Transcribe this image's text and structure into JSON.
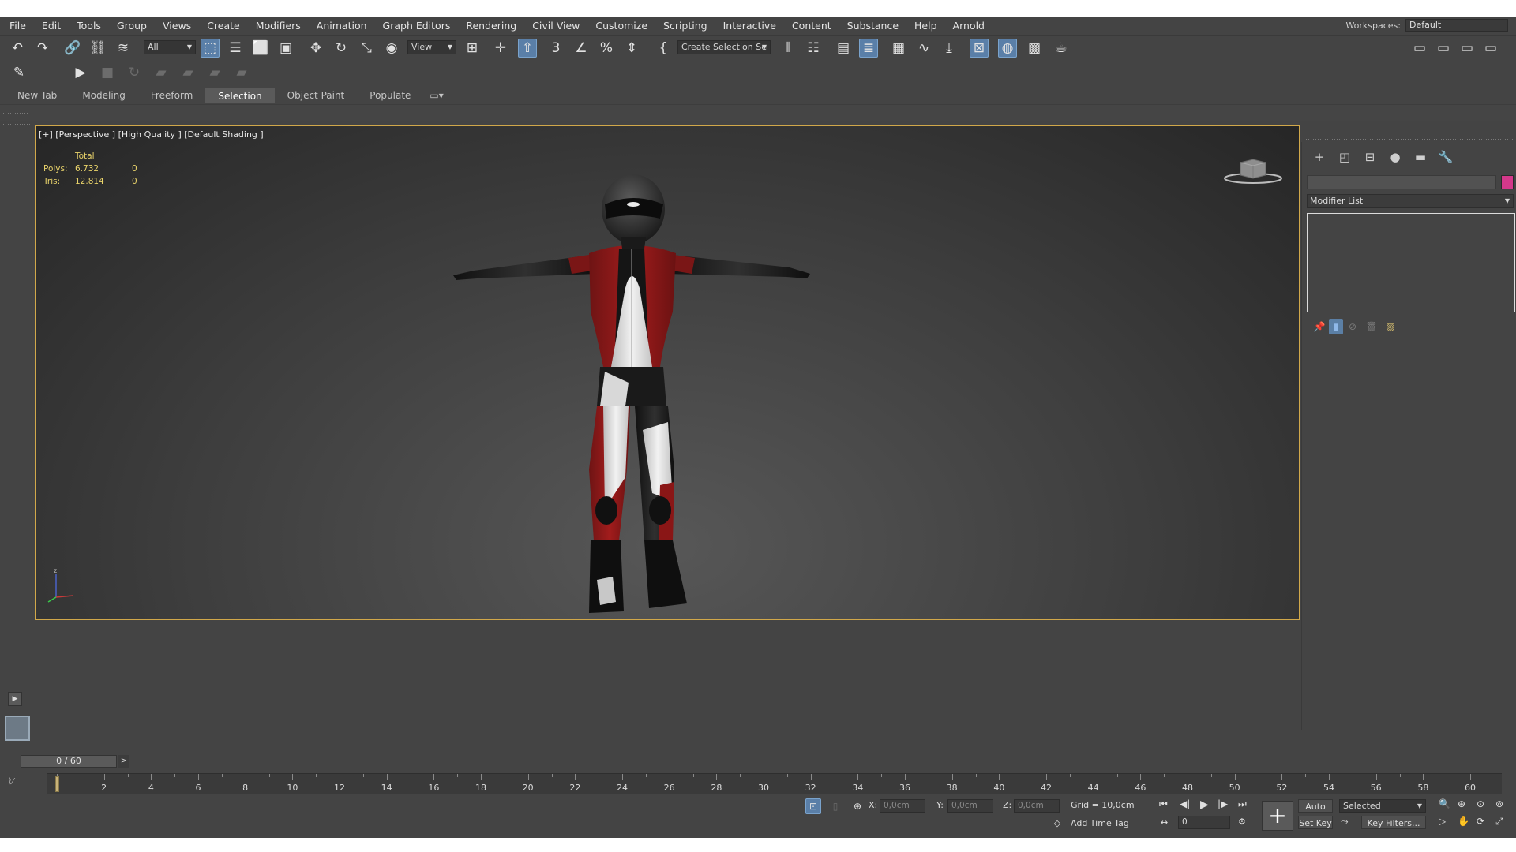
{
  "menubar": {
    "items": [
      "File",
      "Edit",
      "Tools",
      "Group",
      "Views",
      "Create",
      "Modifiers",
      "Animation",
      "Graph Editors",
      "Rendering",
      "Civil View",
      "Customize",
      "Scripting",
      "Interactive",
      "Content",
      "Substance",
      "Help",
      "Arnold"
    ],
    "workspace_label": "Workspaces:",
    "workspace_value": "Default"
  },
  "toolbar": {
    "selection_filter": "All",
    "ref_coord": "View",
    "named_selection": "Create Selection Se",
    "icons": [
      "undo-icon",
      "redo-icon",
      "link-icon",
      "unlink-icon",
      "bind-space-warp-icon",
      "select-object-icon",
      "select-by-name-icon",
      "rectangular-region-icon",
      "window-crossing-icon",
      "move-icon",
      "rotate-icon",
      "scale-icon",
      "place-icon",
      "pivot-icon",
      "manipulate-icon",
      "keyboard-shortcut-icon",
      "snap-3d-icon",
      "angle-snap-icon",
      "percent-snap-icon",
      "spinner-snap-icon",
      "edit-named-sets-icon",
      "mirror-icon",
      "align-icon",
      "scene-explorer-icon",
      "layer-explorer-icon",
      "ribbon-icon",
      "curve-editor-icon",
      "schematic-view-icon",
      "material-editor-icon",
      "render-setup-icon",
      "rendered-frame-window-icon",
      "render-icon"
    ]
  },
  "ribbon": {
    "tabs": [
      "New Tab",
      "Modeling",
      "Freeform",
      "Selection",
      "Object Paint",
      "Populate"
    ],
    "active_tab": "Selection"
  },
  "viewport": {
    "label": "[+] [Perspective ] [High Quality ] [Default Shading ]",
    "stats": {
      "header": "Total",
      "rows": [
        {
          "name": "Polys:",
          "total": "6.732",
          "selected": "0"
        },
        {
          "name": "Tris:",
          "total": "12.814",
          "selected": "0"
        }
      ]
    },
    "border_color": "#d1a84a"
  },
  "command_panel": {
    "tabs": [
      "create-icon",
      "modify-icon",
      "hierarchy-icon",
      "motion-icon",
      "display-icon",
      "utilities-icon"
    ],
    "modifier_list": "Modifier List",
    "object_color": "#d4388a"
  },
  "timeline": {
    "slider_text": "0 / 60",
    "next_label": ">",
    "ticks": [
      "2",
      "4",
      "6",
      "8",
      "10",
      "12",
      "14",
      "16",
      "18",
      "20",
      "22",
      "24",
      "26",
      "28",
      "30",
      "32",
      "34",
      "36",
      "38",
      "40",
      "42",
      "44",
      "46",
      "48",
      "50",
      "52",
      "54",
      "56",
      "58",
      "60"
    ]
  },
  "status": {
    "x_label": "X:",
    "x_value": "0,0cm",
    "y_label": "Y:",
    "y_value": "0,0cm",
    "z_label": "Z:",
    "z_value": "0,0cm",
    "grid": "Grid = 10,0cm",
    "add_time_tag": "Add Time Tag",
    "auto_key": "Auto Key",
    "set_key": "Set Key",
    "selected": "Selected",
    "key_filters": "Key Filters...",
    "frame_value": "0"
  }
}
